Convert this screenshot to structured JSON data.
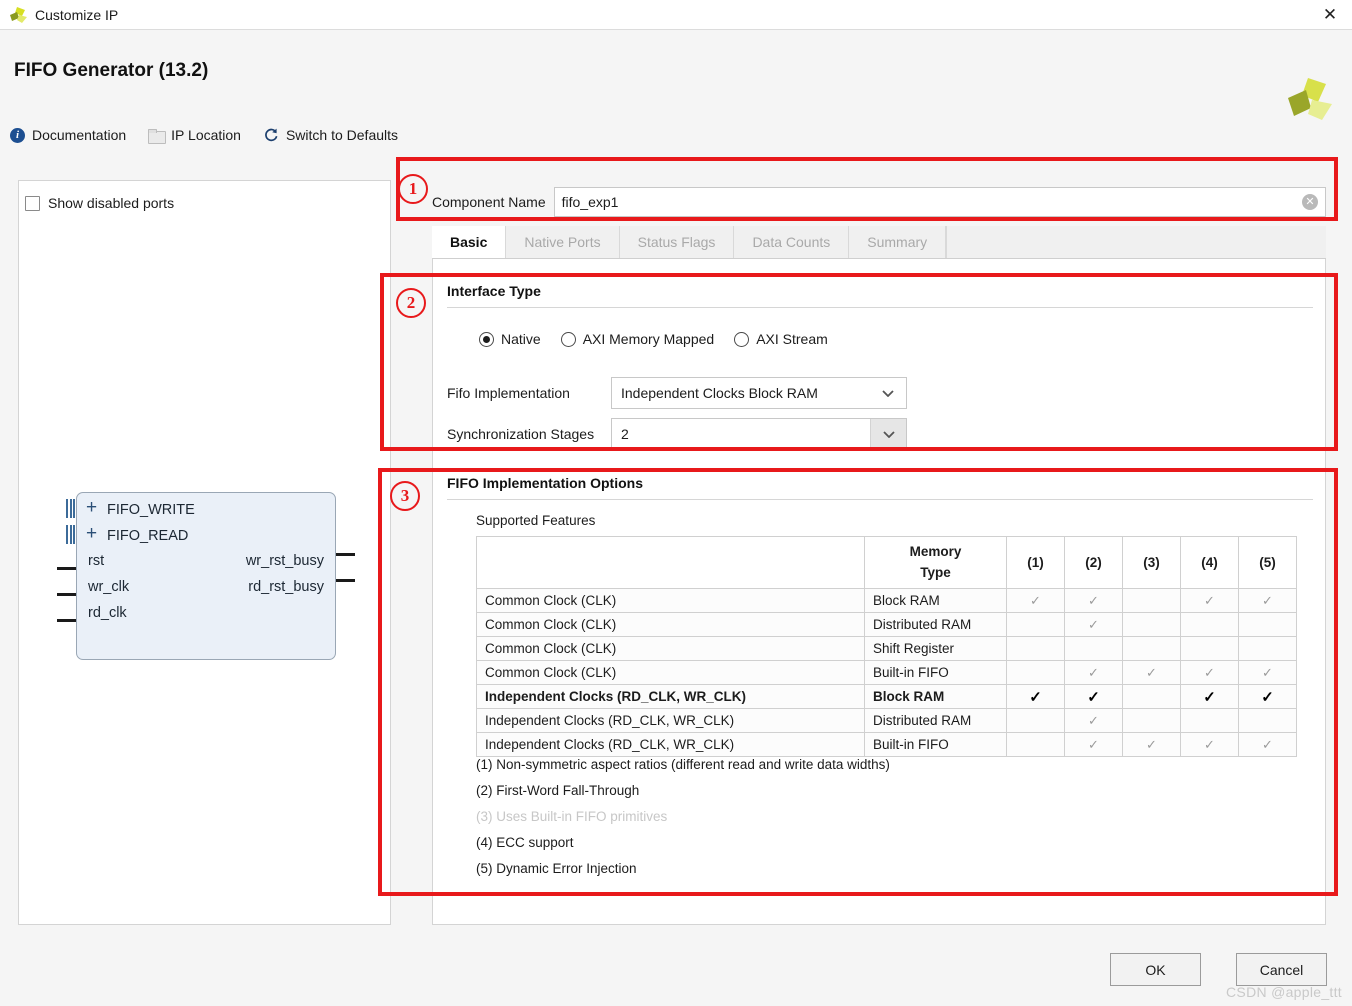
{
  "window": {
    "title": "Customize IP",
    "close_label": "✕",
    "app_icon": "xilinx-logo-icon"
  },
  "header": {
    "title": "FIFO Generator (13.2)",
    "toolbar": [
      {
        "label": "Documentation",
        "icon": "info-icon"
      },
      {
        "label": "IP Location",
        "icon": "folder-icon"
      },
      {
        "label": "Switch to Defaults",
        "icon": "refresh-icon"
      }
    ]
  },
  "left_panel": {
    "show_disabled_ports": {
      "label": "Show disabled ports",
      "checked": false
    },
    "block_diagram": {
      "bus_ports": [
        "FIFO_WRITE",
        "FIFO_READ"
      ],
      "input_ports": [
        "rst",
        "wr_clk",
        "rd_clk"
      ],
      "output_ports": [
        "wr_rst_busy",
        "rd_rst_busy"
      ]
    }
  },
  "component_name": {
    "label": "Component Name",
    "value": "fifo_exp1",
    "clear_icon": "clear-circle-icon"
  },
  "tabs": [
    {
      "label": "Basic",
      "active": true
    },
    {
      "label": "Native Ports",
      "active": false
    },
    {
      "label": "Status Flags",
      "active": false
    },
    {
      "label": "Data Counts",
      "active": false
    },
    {
      "label": "Summary",
      "active": false
    }
  ],
  "interface_type": {
    "section_title": "Interface Type",
    "radios": [
      {
        "label": "Native",
        "selected": true
      },
      {
        "label": "AXI Memory Mapped",
        "selected": false
      },
      {
        "label": "AXI Stream",
        "selected": false
      }
    ],
    "fifo_implementation": {
      "label": "Fifo Implementation",
      "value": "Independent Clocks Block RAM"
    },
    "synchronization_stages": {
      "label": "Synchronization Stages",
      "value": "2"
    }
  },
  "fifo_implementation_options": {
    "section_title": "FIFO Implementation Options",
    "subtitle": "Supported Features",
    "table": {
      "headers": [
        "",
        "Memory\nType",
        "(1)",
        "(2)",
        "(3)",
        "(4)",
        "(5)"
      ],
      "header_memory_line1": "Memory",
      "header_memory_line2": "Type",
      "header_nums": [
        "(1)",
        "(2)",
        "(3)",
        "(4)",
        "(5)"
      ],
      "check_glyph": "✓",
      "rows": [
        {
          "feature": "Common Clock (CLK)",
          "memory": "Block RAM",
          "checks": [
            true,
            true,
            false,
            true,
            true
          ],
          "highlight": false
        },
        {
          "feature": "Common Clock (CLK)",
          "memory": "Distributed RAM",
          "checks": [
            false,
            true,
            false,
            false,
            false
          ],
          "highlight": false
        },
        {
          "feature": "Common Clock (CLK)",
          "memory": "Shift Register",
          "checks": [
            false,
            false,
            false,
            false,
            false
          ],
          "highlight": false
        },
        {
          "feature": "Common Clock (CLK)",
          "memory": "Built-in FIFO",
          "checks": [
            false,
            true,
            true,
            true,
            true
          ],
          "highlight": false
        },
        {
          "feature": "Independent Clocks (RD_CLK, WR_CLK)",
          "memory": "Block RAM",
          "checks": [
            true,
            true,
            false,
            true,
            true
          ],
          "highlight": true
        },
        {
          "feature": "Independent Clocks (RD_CLK, WR_CLK)",
          "memory": "Distributed RAM",
          "checks": [
            false,
            true,
            false,
            false,
            false
          ],
          "highlight": false
        },
        {
          "feature": "Independent Clocks (RD_CLK, WR_CLK)",
          "memory": "Built-in FIFO",
          "checks": [
            false,
            true,
            true,
            true,
            true
          ],
          "highlight": false
        }
      ]
    },
    "footnotes": [
      {
        "text": "(1) Non-symmetric aspect ratios (different read and write data widths)",
        "dim": false
      },
      {
        "text": "(2) First-Word Fall-Through",
        "dim": false
      },
      {
        "text": "(3) Uses Built-in FIFO primitives",
        "dim": true
      },
      {
        "text": "(4) ECC support",
        "dim": false
      },
      {
        "text": "(5) Dynamic Error Injection",
        "dim": false
      }
    ]
  },
  "footer": {
    "ok_label": "OK",
    "cancel_label": "Cancel"
  },
  "annotations": {
    "markers": [
      "1",
      "2",
      "3"
    ],
    "color": "#e8191b"
  },
  "watermark": "CSDN @apple_ttt"
}
